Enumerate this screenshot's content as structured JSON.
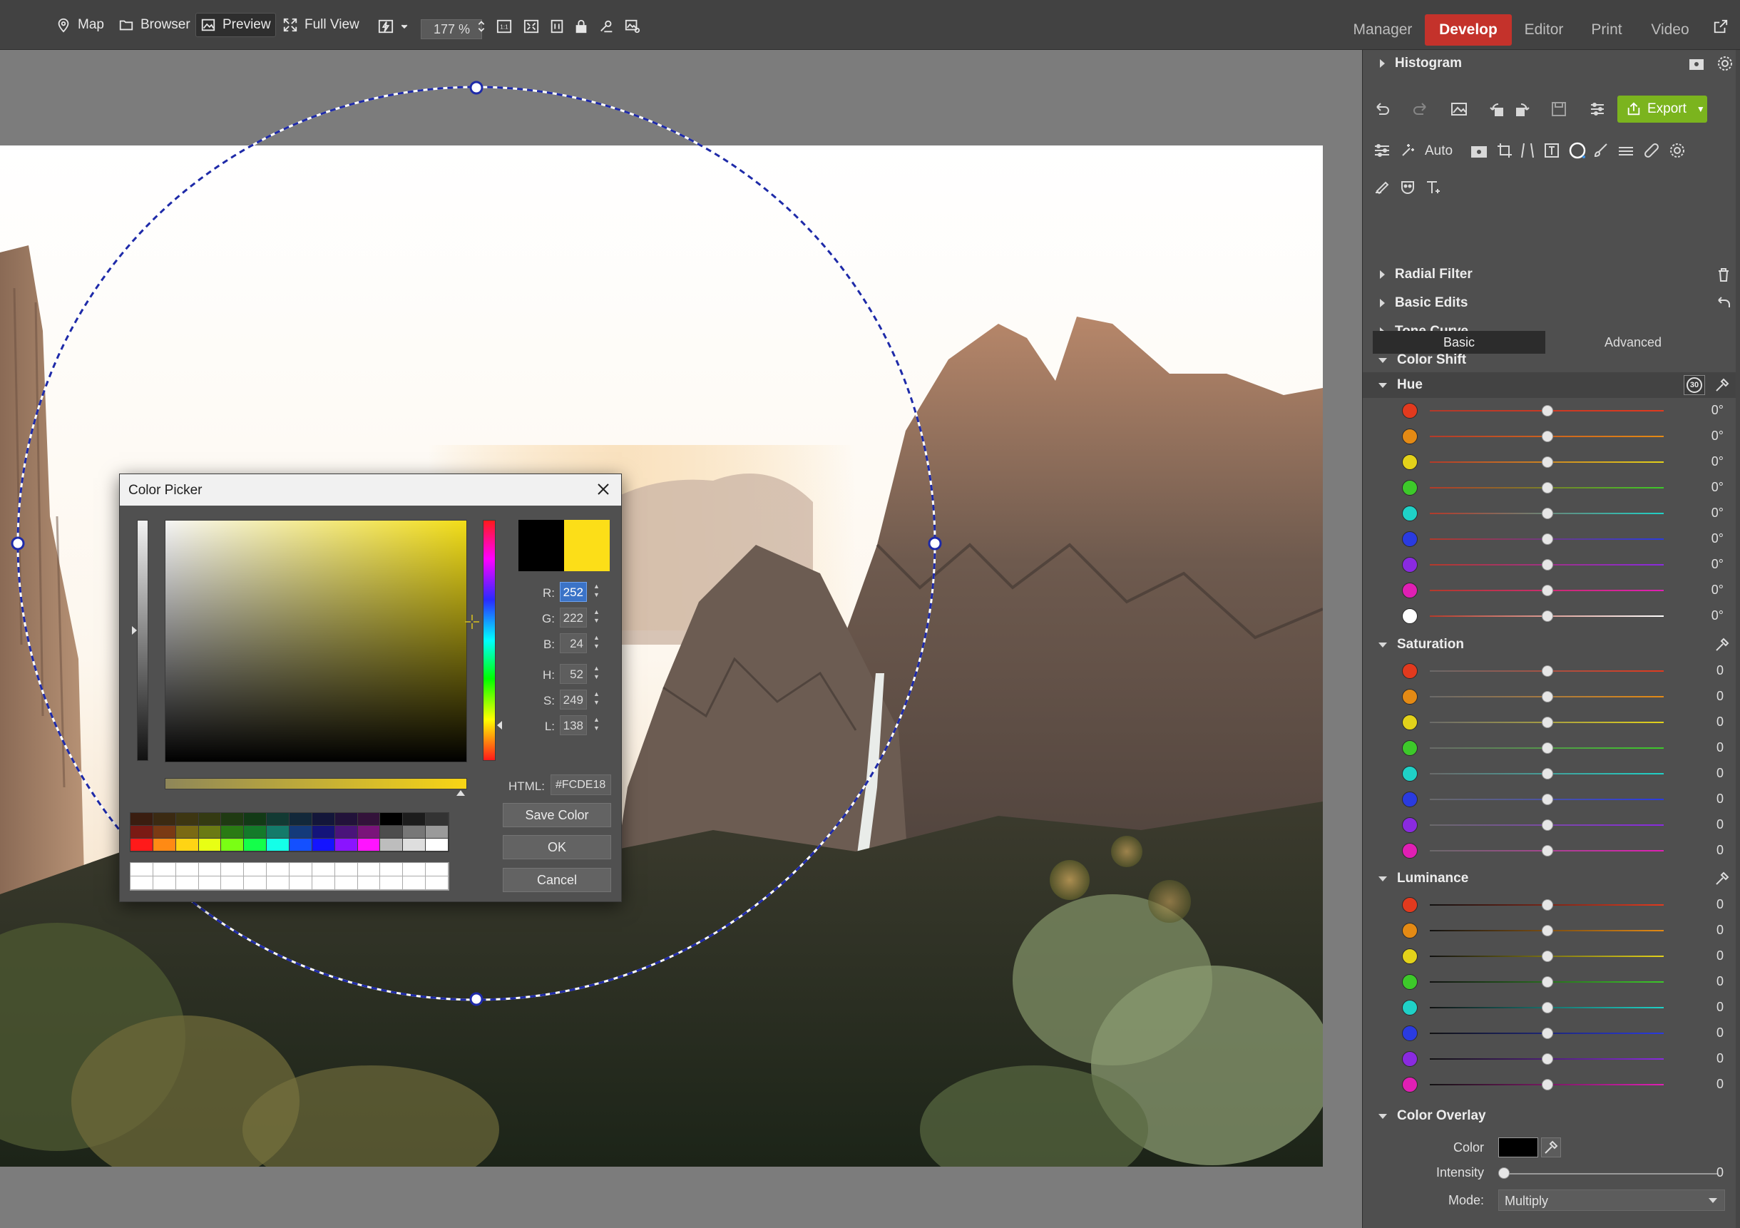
{
  "toolbar": {
    "map": "Map",
    "browser": "Browser",
    "preview": "Preview",
    "fullview": "Full View",
    "zoom": "177 %",
    "one_to_one": "1:1"
  },
  "modes": {
    "manager": "Manager",
    "develop": "Develop",
    "editor": "Editor",
    "print": "Print",
    "video": "Video"
  },
  "panel": {
    "histogram": "Histogram",
    "export": "Export",
    "auto": "Auto",
    "radial_filter": "Radial Filter",
    "basic_edits": "Basic Edits",
    "tone_curve": "Tone Curve",
    "color_shift": "Color Shift",
    "tab_basic": "Basic",
    "tab_advanced": "Advanced",
    "hue": {
      "title": "Hue",
      "badge": "30",
      "rows": [
        {
          "color": "#e23a1e",
          "value": "0°"
        },
        {
          "color": "#e48a14",
          "value": "0°"
        },
        {
          "color": "#e3d21a",
          "value": "0°"
        },
        {
          "color": "#3dc92a",
          "value": "0°"
        },
        {
          "color": "#1fd1c7",
          "value": "0°"
        },
        {
          "color": "#2a3be0",
          "value": "0°"
        },
        {
          "color": "#8a2ae0",
          "value": "0°"
        },
        {
          "color": "#e01fb4",
          "value": "0°"
        },
        {
          "color": "#ffffff",
          "value": "0°"
        }
      ]
    },
    "saturation": {
      "title": "Saturation",
      "rows": [
        {
          "color": "#e23a1e",
          "value": "0"
        },
        {
          "color": "#e48a14",
          "value": "0"
        },
        {
          "color": "#e3d21a",
          "value": "0"
        },
        {
          "color": "#3dc92a",
          "value": "0"
        },
        {
          "color": "#1fd1c7",
          "value": "0"
        },
        {
          "color": "#2a3be0",
          "value": "0"
        },
        {
          "color": "#8a2ae0",
          "value": "0"
        },
        {
          "color": "#e01fb4",
          "value": "0"
        }
      ]
    },
    "luminance": {
      "title": "Luminance",
      "rows": [
        {
          "color": "#e23a1e",
          "value": "0"
        },
        {
          "color": "#e48a14",
          "value": "0"
        },
        {
          "color": "#e3d21a",
          "value": "0"
        },
        {
          "color": "#3dc92a",
          "value": "0"
        },
        {
          "color": "#1fd1c7",
          "value": "0"
        },
        {
          "color": "#2a3be0",
          "value": "0"
        },
        {
          "color": "#8a2ae0",
          "value": "0"
        },
        {
          "color": "#e01fb4",
          "value": "0"
        }
      ]
    },
    "overlay": {
      "title": "Color Overlay",
      "color_label": "Color",
      "color_value": "#000000",
      "intensity_label": "Intensity",
      "intensity_value": "0",
      "mode_label": "Mode:",
      "mode_value": "Multiply"
    }
  },
  "picker": {
    "title": "Color Picker",
    "old_color": "#000000",
    "new_color": "#fcde18",
    "r_label": "R:",
    "r": "252",
    "g_label": "G:",
    "g": "222",
    "b_label": "B:",
    "b": "24",
    "h_label": "H:",
    "h": "52",
    "s_label": "S:",
    "s": "249",
    "l_label": "L:",
    "l": "138",
    "html_label": "HTML:",
    "html": "#FCDE18",
    "save_color": "Save Color",
    "ok": "OK",
    "cancel": "Cancel",
    "palette": [
      "#3a1d10",
      "#3b2a12",
      "#3d3612",
      "#343a12",
      "#1f3a12",
      "#123a16",
      "#123a33",
      "#12283a",
      "#13163a",
      "#22123a",
      "#33123a",
      "#000000",
      "#1c1c1c",
      "#333333",
      "#7a1a14",
      "#7a3a14",
      "#7a6a14",
      "#6a7a14",
      "#2a7a14",
      "#147a2a",
      "#147a6a",
      "#143a7a",
      "#14147a",
      "#4a147a",
      "#7a147a",
      "#4d4d4d",
      "#777777",
      "#9a9a9a",
      "#ff1a1a",
      "#ff8a14",
      "#ffd414",
      "#e8ff14",
      "#7aff14",
      "#14ff4a",
      "#14ffe8",
      "#1450ff",
      "#1414ff",
      "#8a14ff",
      "#ff14ff",
      "#bdbdbd",
      "#dedede",
      "#ffffff"
    ]
  }
}
